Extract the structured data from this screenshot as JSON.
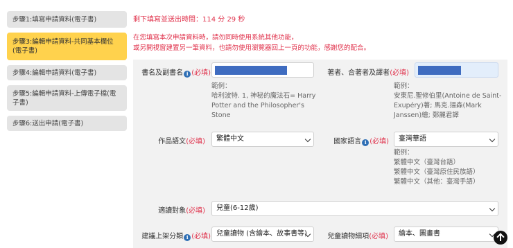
{
  "sidebar": {
    "steps": [
      {
        "label": "步驟1:填寫申請資料(電子書)"
      },
      {
        "label": "步驟3:編輯申請資料-共同基本欄位(電子書)"
      },
      {
        "label": "步驟4:編輯申請資料(電子書)"
      },
      {
        "label": "步驟5:編輯申請資料-上傳電子檔(電子書)"
      },
      {
        "label": "步驟6:送出申請(電子書)"
      }
    ],
    "active_color": "#ffd24d"
  },
  "header": {
    "timer": "剩下填寫並送出時間：114 分 29 秒",
    "warning_line1": "在您填寫本次申請資料時，請勿同時使用系統其他功能，",
    "warning_line2": "或另開視窗建置另一筆資料，也請勿使用瀏覽器回上一頁的功能，感謝您的配合。"
  },
  "form": {
    "required_mark": "(必填)",
    "title_label": "書名及副書名",
    "title_example": [
      "範例：",
      "哈利波特. 1, 神秘的魔法石= Harry",
      "Potter and the Philosopher's",
      "Stone"
    ],
    "author_label": "著者、合著者及譯者",
    "author_example": [
      "範例：",
      "安東尼.聖修伯里(Antoine de Saint-",
      "Exupéry)著; 馬克.揚森(Mark",
      "Janssen)繪; 鄭麗君譯"
    ],
    "work_lang_label": "作品語文",
    "work_lang_value": "繁體中文",
    "national_lang_label": "國家語言",
    "national_lang_value": "臺灣華語",
    "national_lang_example": [
      "範例：",
      "繁體中文（臺灣台語）",
      "繁體中文（臺灣原住民族語）",
      "繁體中文（其他：臺灣手語）"
    ],
    "audience_label": "適讀對象",
    "audience_value": "兒童(6-12歲)",
    "shelf_label": "建議上架分類",
    "shelf_value": "兒童讀物 (含繪本、故事書等)",
    "kids_sub_label": "兒童讀物細項",
    "kids_sub_value": "繪本、圖畫書"
  },
  "icons": {
    "info": "info-icon",
    "scroll_top": "arrow-up-icon"
  },
  "colors": {
    "required": "#e0314b",
    "info": "#2f6fb5",
    "redaction": "#3f6cc0"
  }
}
